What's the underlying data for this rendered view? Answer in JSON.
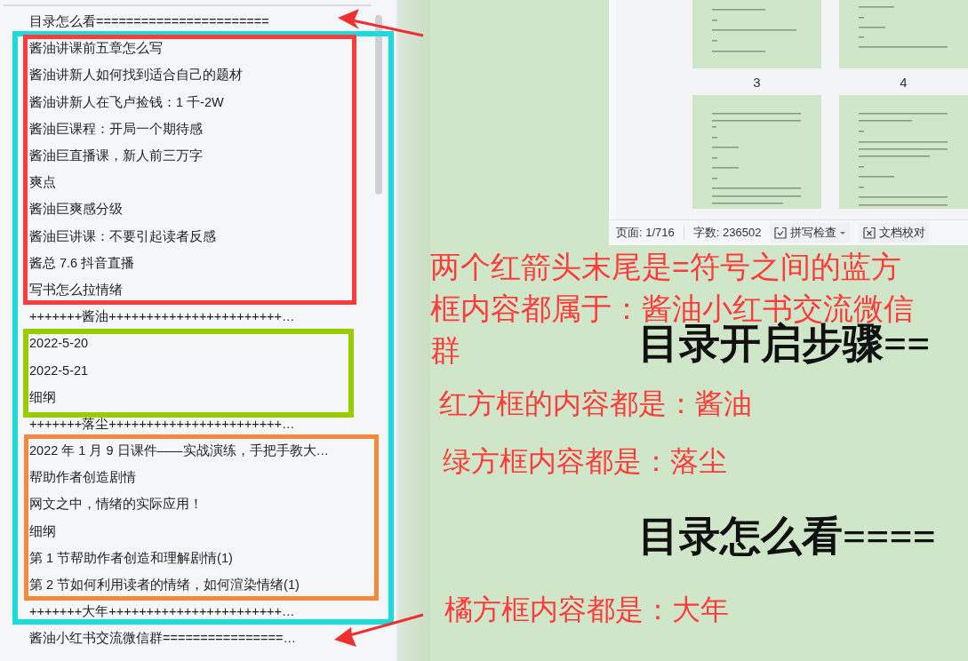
{
  "nav_pane": {
    "items": [
      {
        "text": "目录怎么看======================="
      },
      {
        "text": "酱油讲课前五章怎么写"
      },
      {
        "text": "酱油讲新人如何找到适合自己的题材"
      },
      {
        "text": "酱油讲新人在飞卢捡钱：1 千-2W"
      },
      {
        "text": "酱油巨课程：开局一个期待感"
      },
      {
        "text": "酱油巨直播课，新人前三万字"
      },
      {
        "text": "爽点"
      },
      {
        "text": "酱油巨爽感分级"
      },
      {
        "text": "酱油巨讲课：不要引起读者反感"
      },
      {
        "text": "酱总 7.6 抖音直播"
      },
      {
        "text": "写书怎么拉情绪"
      },
      {
        "text": "+++++++酱油+++++++++++++++++++++++…"
      },
      {
        "text": "2022-5-20"
      },
      {
        "text": "2022-5-21"
      },
      {
        "text": "细纲"
      },
      {
        "text": "+++++++落尘+++++++++++++++++++++++…"
      },
      {
        "text": "2022 年 1 月 9 日课件——实战演练，手把手教大…"
      },
      {
        "text": "帮助作者创造剧情"
      },
      {
        "text": "网文之中，情绪的实际应用！"
      },
      {
        "text": "细纲"
      },
      {
        "text": "第 1 节帮助作者创造和理解剧情(1)"
      },
      {
        "text": "第 2 节如何利用读者的情绪，如何渲染情绪(1)"
      },
      {
        "text": "+++++++大年+++++++++++++++++++++++…"
      },
      {
        "text": "酱油小红书交流微信群================…"
      }
    ]
  },
  "thumbnails": {
    "pages": [
      {
        "number": "3"
      },
      {
        "number": "4"
      }
    ]
  },
  "status_bar": {
    "page": "页面: 1/716",
    "words": "字数: 236502",
    "spell_check": "拼写检查",
    "proofread": "文档校对"
  },
  "document": {
    "headings": [
      "目录开启步骤==",
      "目录怎么看===="
    ]
  },
  "annotations": {
    "frames": [
      {
        "color": "#1adcdc"
      },
      {
        "color": "#ff3b3b"
      },
      {
        "color": "#99cc00"
      },
      {
        "color": "#f5883a"
      }
    ],
    "arrows": [
      {
        "kind": "arrow"
      },
      {
        "kind": "arrow"
      }
    ],
    "notes": [
      {
        "lines": [
          "两个红箭头末尾是=符号之间的蓝方",
          "框内容都属于：酱油小红书交流微信",
          "群"
        ]
      },
      {
        "lines": [
          "红方框的内容都是：酱油"
        ]
      },
      {
        "lines": [
          "绿方框内容都是：落尘"
        ]
      },
      {
        "lines": [
          "橘方框内容都是：大年"
        ]
      }
    ]
  }
}
